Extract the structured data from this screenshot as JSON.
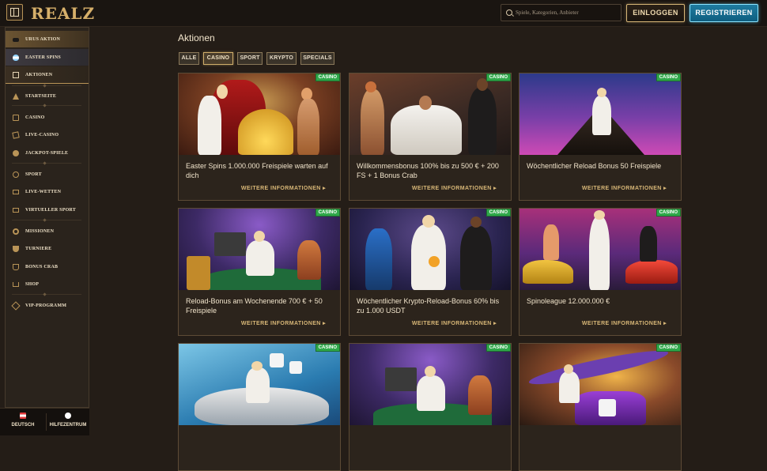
{
  "header": {
    "logo": "REALZ",
    "search_placeholder": "Spiele, Kategorien, Anbieter",
    "login_label": "EINLOGGEN",
    "register_label": "REGISTRIEREN"
  },
  "sidebar": {
    "items": [
      {
        "label": "URUS AKTION",
        "icon": "car-icon"
      },
      {
        "label": "EASTER SPINS",
        "icon": "easter-egg-icon"
      },
      {
        "label": "AKTIONEN",
        "icon": "gift-icon"
      },
      {
        "label": "STARTSEITE",
        "icon": "pyramid-icon"
      },
      {
        "label": "CASINO",
        "icon": "slot-machine-icon"
      },
      {
        "label": "LIVE-CASINO",
        "icon": "cards-icon"
      },
      {
        "label": "JACKPOT-SPIELE",
        "icon": "coins-icon"
      },
      {
        "label": "SPORT",
        "icon": "ball-icon"
      },
      {
        "label": "LIVE-WETTEN",
        "icon": "tv-icon"
      },
      {
        "label": "VIRTUELLER SPORT",
        "icon": "monitor-icon"
      },
      {
        "label": "MISSIONEN",
        "icon": "target-icon"
      },
      {
        "label": "TURNIERE",
        "icon": "trophy-icon"
      },
      {
        "label": "BONUS CRAB",
        "icon": "crab-icon"
      },
      {
        "label": "SHOP",
        "icon": "cart-icon"
      },
      {
        "label": "VIP-PROGRAMM",
        "icon": "diamond-icon"
      }
    ],
    "footer": {
      "language": "DEUTSCH",
      "help": "HILFEZENTRUM"
    }
  },
  "main": {
    "title": "Aktionen",
    "filters": [
      "ALLE",
      "CASINO",
      "SPORT",
      "KRYPTO",
      "SPECIALS"
    ],
    "active_filter": "CASINO",
    "more_label": "WEITERE INFORMATIONEN",
    "tag": "CASINO",
    "cards": [
      {
        "title": "Easter Spins 1.000.000 Freispiele warten auf dich"
      },
      {
        "title": "Willkommensbonus 100% bis zu 500 € + 200 FS + 1 Bonus Crab"
      },
      {
        "title": "Wöchentlicher Reload Bonus 50 Freispiele"
      },
      {
        "title": "Reload-Bonus am Wochenende 700 € + 50 Freispiele"
      },
      {
        "title": "Wöchentlicher Krypto-Reload-Bonus 60% bis zu 1.000 USDT"
      },
      {
        "title": "Spinoleague 12.000.000 €"
      },
      {
        "title": ""
      },
      {
        "title": ""
      },
      {
        "title": ""
      }
    ]
  },
  "colors": {
    "accent_gold": "#d8b777",
    "register_blue": "#1f7ca0",
    "tag_green": "#2fa84a"
  }
}
